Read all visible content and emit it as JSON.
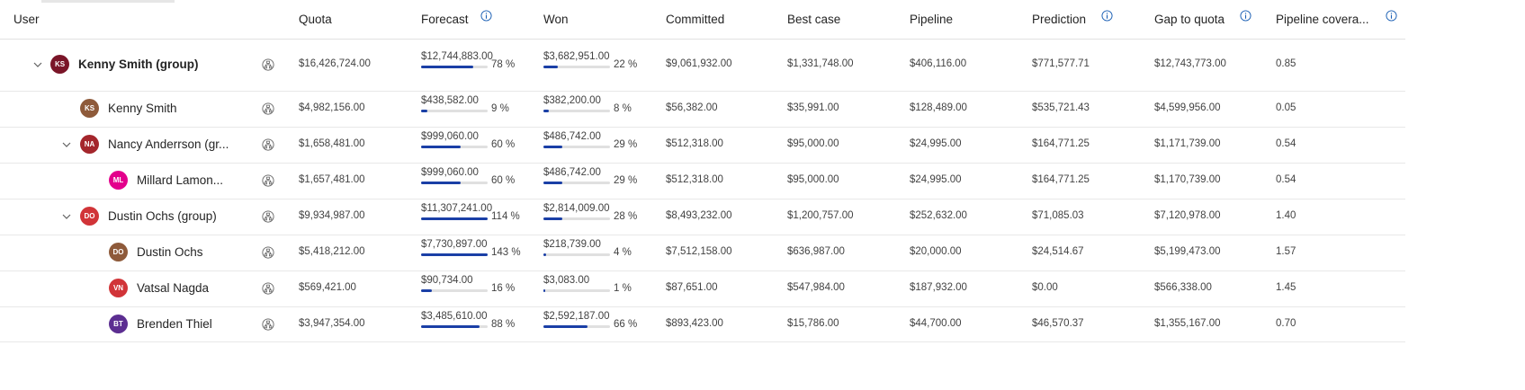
{
  "columns": {
    "user": "User",
    "quota": "Quota",
    "forecast": "Forecast",
    "won": "Won",
    "committed": "Committed",
    "best_case": "Best case",
    "pipeline": "Pipeline",
    "prediction": "Prediction",
    "gap_to_quota": "Gap to quota",
    "pipeline_coverage": "Pipeline covera..."
  },
  "colors": {
    "bar_fill": "#1a3fa6",
    "bar_track": "#e0e0e0",
    "info_icon": "#1a5fb4"
  },
  "rows": [
    {
      "name": "Kenny Smith (group)",
      "initials": "KS",
      "avatar_color": "#7a1528",
      "expandable": true,
      "bold": true,
      "quota": "$16,426,724.00",
      "forecast": {
        "value": "$12,744,883.00",
        "pct": "78 %",
        "fill": 0.78
      },
      "won": {
        "value": "$3,682,951.00",
        "pct": "22 %",
        "fill": 0.22
      },
      "committed": "$9,061,932.00",
      "best_case": "$1,331,748.00",
      "pipeline": "$406,116.00",
      "prediction": "$771,577.71",
      "gap_to_quota": "$12,743,773.00",
      "pipeline_coverage": "0.85"
    },
    {
      "name": "Kenny Smith",
      "initials": "KS",
      "avatar_color": "#8e5a3a",
      "expandable": false,
      "bold": false,
      "quota": "$4,982,156.00",
      "forecast": {
        "value": "$438,582.00",
        "pct": "9 %",
        "fill": 0.09
      },
      "won": {
        "value": "$382,200.00",
        "pct": "8 %",
        "fill": 0.08
      },
      "committed": "$56,382.00",
      "best_case": "$35,991.00",
      "pipeline": "$128,489.00",
      "prediction": "$535,721.43",
      "gap_to_quota": "$4,599,956.00",
      "pipeline_coverage": "0.05"
    },
    {
      "name": "Nancy Anderrson (gr...",
      "initials": "NA",
      "avatar_color": "#a4262c",
      "expandable": true,
      "bold": false,
      "quota": "$1,658,481.00",
      "forecast": {
        "value": "$999,060.00",
        "pct": "60 %",
        "fill": 0.6
      },
      "won": {
        "value": "$486,742.00",
        "pct": "29 %",
        "fill": 0.29
      },
      "committed": "$512,318.00",
      "best_case": "$95,000.00",
      "pipeline": "$24,995.00",
      "prediction": "$164,771.25",
      "gap_to_quota": "$1,171,739.00",
      "pipeline_coverage": "0.54"
    },
    {
      "name": "Millard Lamon...",
      "initials": "ML",
      "avatar_color": "#e3008c",
      "expandable": false,
      "bold": false,
      "quota": "$1,657,481.00",
      "forecast": {
        "value": "$999,060.00",
        "pct": "60 %",
        "fill": 0.6
      },
      "won": {
        "value": "$486,742.00",
        "pct": "29 %",
        "fill": 0.29
      },
      "committed": "$512,318.00",
      "best_case": "$95,000.00",
      "pipeline": "$24,995.00",
      "prediction": "$164,771.25",
      "gap_to_quota": "$1,170,739.00",
      "pipeline_coverage": "0.54"
    },
    {
      "name": "Dustin Ochs (group)",
      "initials": "DO",
      "avatar_color": "#d13438",
      "expandable": true,
      "bold": false,
      "quota": "$9,934,987.00",
      "forecast": {
        "value": "$11,307,241.00",
        "pct": "114 %",
        "fill": 1.0
      },
      "won": {
        "value": "$2,814,009.00",
        "pct": "28 %",
        "fill": 0.28
      },
      "committed": "$8,493,232.00",
      "best_case": "$1,200,757.00",
      "pipeline": "$252,632.00",
      "prediction": "$71,085.03",
      "gap_to_quota": "$7,120,978.00",
      "pipeline_coverage": "1.40"
    },
    {
      "name": "Dustin Ochs",
      "initials": "DO",
      "avatar_color": "#8e5a3a",
      "expandable": false,
      "bold": false,
      "quota": "$5,418,212.00",
      "forecast": {
        "value": "$7,730,897.00",
        "pct": "143 %",
        "fill": 1.0
      },
      "won": {
        "value": "$218,739.00",
        "pct": "4 %",
        "fill": 0.04
      },
      "committed": "$7,512,158.00",
      "best_case": "$636,987.00",
      "pipeline": "$20,000.00",
      "prediction": "$24,514.67",
      "gap_to_quota": "$5,199,473.00",
      "pipeline_coverage": "1.57"
    },
    {
      "name": "Vatsal Nagda",
      "initials": "VN",
      "avatar_color": "#d13438",
      "expandable": false,
      "bold": false,
      "quota": "$569,421.00",
      "forecast": {
        "value": "$90,734.00",
        "pct": "16 %",
        "fill": 0.16
      },
      "won": {
        "value": "$3,083.00",
        "pct": "1 %",
        "fill": 0.01
      },
      "committed": "$87,651.00",
      "best_case": "$547,984.00",
      "pipeline": "$187,932.00",
      "prediction": "$0.00",
      "gap_to_quota": "$566,338.00",
      "pipeline_coverage": "1.45"
    },
    {
      "name": "Brenden Thiel",
      "initials": "BT",
      "avatar_color": "#5c2e91",
      "expandable": false,
      "bold": false,
      "quota": "$3,947,354.00",
      "forecast": {
        "value": "$3,485,610.00",
        "pct": "88 %",
        "fill": 0.88
      },
      "won": {
        "value": "$2,592,187.00",
        "pct": "66 %",
        "fill": 0.66
      },
      "committed": "$893,423.00",
      "best_case": "$15,786.00",
      "pipeline": "$44,700.00",
      "prediction": "$46,570.37",
      "gap_to_quota": "$1,355,167.00",
      "pipeline_coverage": "0.70"
    }
  ]
}
